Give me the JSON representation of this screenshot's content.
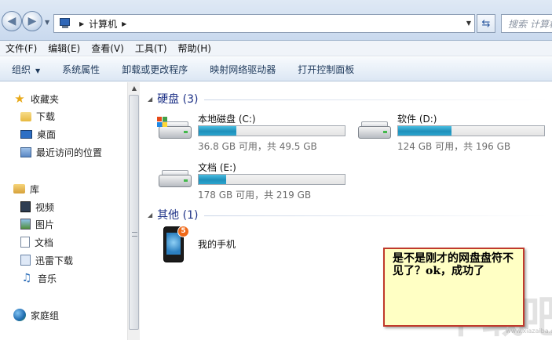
{
  "address_bar": {
    "breadcrumb": "计算机",
    "search_placeholder": "搜索 计算机"
  },
  "menu": {
    "items": [
      "文件(F)",
      "编辑(E)",
      "查看(V)",
      "工具(T)",
      "帮助(H)"
    ]
  },
  "toolbar": {
    "items": [
      "组织",
      "系统属性",
      "卸载或更改程序",
      "映射网络驱动器",
      "打开控制面板"
    ]
  },
  "nav_pane": {
    "favorites": {
      "label": "收藏夹",
      "items": [
        "下载",
        "桌面",
        "最近访问的位置"
      ]
    },
    "libraries": {
      "label": "库",
      "items": [
        "视频",
        "图片",
        "文档",
        "迅雷下载",
        "音乐"
      ]
    },
    "homegroup": {
      "label": "家庭组"
    }
  },
  "content": {
    "hard_disks": {
      "title": "硬盘 (3)",
      "drives": [
        {
          "name": "本地磁盘 (C:)",
          "free": "36.8 GB 可用，共 49.5 GB",
          "used_fraction": 0.257,
          "has_windows": true
        },
        {
          "name": "软件 (D:)",
          "free": "124 GB 可用，共 196 GB",
          "used_fraction": 0.367,
          "has_windows": false
        },
        {
          "name": "文档 (E:)",
          "free": "178 GB 可用，共 219 GB",
          "used_fraction": 0.187,
          "has_windows": false
        }
      ]
    },
    "others": {
      "title": "其他 (1)",
      "devices": [
        {
          "name": "我的手机",
          "badge": "5"
        }
      ]
    }
  },
  "annotation": {
    "text": "是不是刚才的网盘盘符不见了？ok，成功了"
  },
  "watermark": {
    "text": "下载吧",
    "url": "www.xiazaiba.com"
  }
}
